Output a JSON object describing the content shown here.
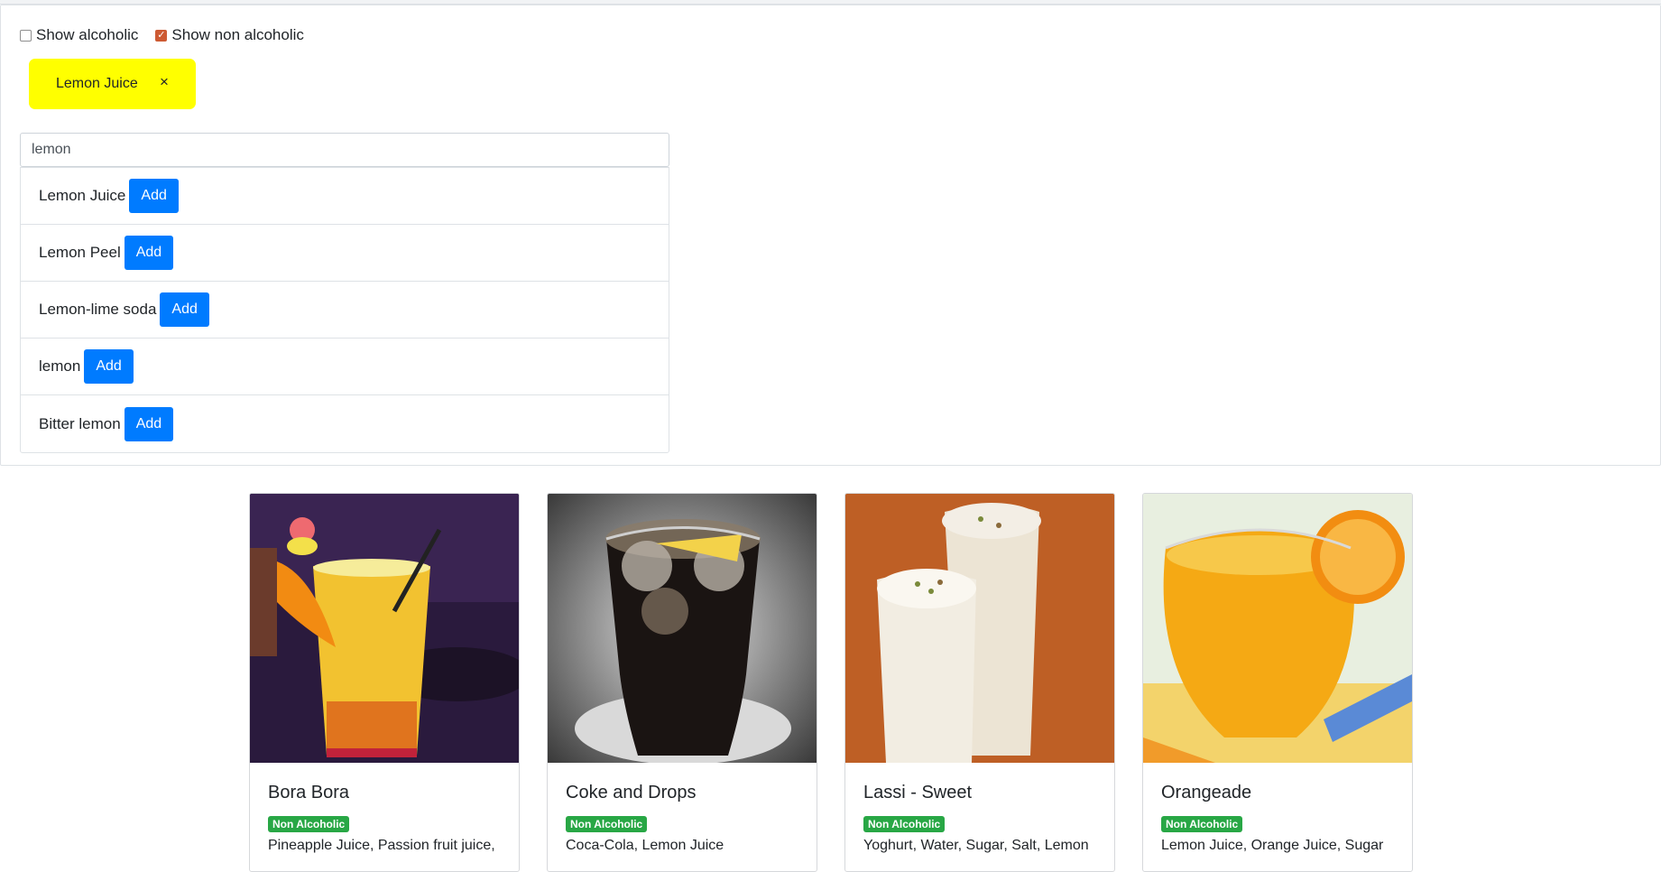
{
  "filters": {
    "alcoholic": {
      "label": "Show alcoholic",
      "checked": false
    },
    "non_alcoholic": {
      "label": "Show non alcoholic",
      "checked": true
    }
  },
  "selected_ingredient": {
    "label": "Lemon Juice",
    "close_glyph": "×"
  },
  "search": {
    "value": "lemon"
  },
  "results": [
    {
      "label": "Lemon Juice",
      "button": "Add"
    },
    {
      "label": "Lemon Peel",
      "button": "Add"
    },
    {
      "label": "Lemon-lime soda",
      "button": "Add"
    },
    {
      "label": "lemon",
      "button": "Add"
    },
    {
      "label": "Bitter lemon",
      "button": "Add"
    }
  ],
  "cards": [
    {
      "title": "Bora Bora",
      "badge": "Non Alcoholic",
      "ingredients": "Pineapple Juice, Passion fruit juice,"
    },
    {
      "title": "Coke and Drops",
      "badge": "Non Alcoholic",
      "ingredients": "Coca-Cola, Lemon Juice"
    },
    {
      "title": "Lassi - Sweet",
      "badge": "Non Alcoholic",
      "ingredients": "Yoghurt, Water, Sugar, Salt, Lemon"
    },
    {
      "title": "Orangeade",
      "badge": "Non Alcoholic",
      "ingredients": "Lemon Juice, Orange Juice, Sugar"
    }
  ],
  "colors": {
    "chip_bg": "#ffff00",
    "add_button": "#007bff",
    "badge": "#28a745",
    "checkbox_accent": "#cd5a33"
  }
}
